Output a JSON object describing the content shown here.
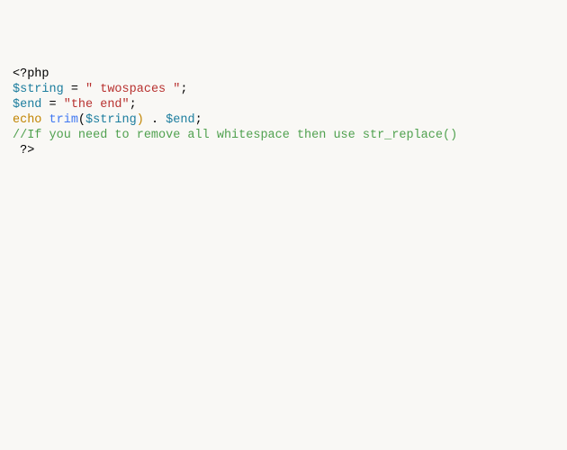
{
  "code": {
    "line1_open": "<?php",
    "line2_var": "$string",
    "line2_eq": " = ",
    "line2_str": "\" twospaces \"",
    "line2_semi": ";",
    "line3_var": "$end",
    "line3_eq": " = ",
    "line3_str": "\"the end\"",
    "line3_semi": ";",
    "line4_echo": "echo",
    "line4_sp1": " ",
    "line4_trim": "trim",
    "line4_open_paren": "(",
    "line4_arg": "$string",
    "line4_close_paren": ")",
    "line4_concat": " . ",
    "line4_end": "$end",
    "line4_semi": ";",
    "line5_comment": "//If you need to remove all whitespace then use str_replace()",
    "line6_closepre": " ",
    "line6_close": "?>"
  }
}
